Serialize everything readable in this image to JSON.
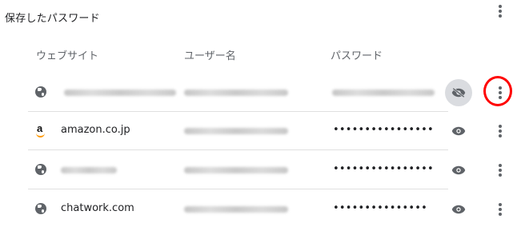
{
  "section": {
    "title": "保存したパスワード"
  },
  "columns": {
    "site": "ウェブサイト",
    "username": "ユーザー名",
    "password": "パスワード"
  },
  "rows": [
    {
      "site": "",
      "username": "",
      "password": "",
      "password_visible": true,
      "icon": "globe-icon"
    },
    {
      "site": "amazon.co.jp",
      "username": "",
      "password": "••••••••••••••••••",
      "password_visible": false,
      "icon": "amazon-logo-icon"
    },
    {
      "site": "",
      "username": "",
      "password": "••••••••••••••••••",
      "password_visible": false,
      "icon": "globe-icon"
    },
    {
      "site": "chatwork.com",
      "username": "",
      "password": "•••••••••••••••",
      "password_visible": false,
      "icon": "globe-icon"
    }
  ],
  "colors": {
    "icon_gray": "#5f6368",
    "divider": "#e0e0e0",
    "highlight_circle": "#ff0000",
    "amazon_orange": "#ff9900"
  }
}
